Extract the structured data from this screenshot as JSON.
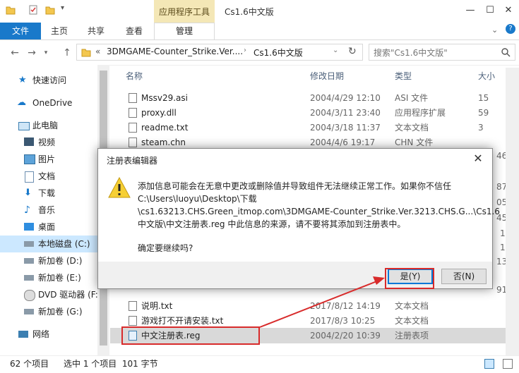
{
  "window": {
    "title": "Cs1.6中文版",
    "context_tab": "应用程序工具",
    "controls": [
      "—",
      "☐",
      "✕"
    ]
  },
  "ribbon": {
    "file": "文件",
    "tabs": [
      "主页",
      "共享",
      "查看"
    ],
    "manage": "管理"
  },
  "address": {
    "overflow": "«",
    "segments": [
      "3DMGAME-Counter_Strike.Ver....",
      "Cs1.6中文版"
    ],
    "search_placeholder": "搜索\"Cs1.6中文版\""
  },
  "nav": {
    "items": [
      {
        "label": "快速访问",
        "icon": "star-icon"
      },
      {
        "label": "OneDrive",
        "icon": "cloud-icon"
      },
      {
        "label": "此电脑",
        "icon": "computer-icon"
      },
      {
        "label": "视频",
        "icon": "video-icon"
      },
      {
        "label": "图片",
        "icon": "picture-icon"
      },
      {
        "label": "文档",
        "icon": "document-icon"
      },
      {
        "label": "下载",
        "icon": "download-icon"
      },
      {
        "label": "音乐",
        "icon": "music-icon"
      },
      {
        "label": "桌面",
        "icon": "desktop-icon"
      },
      {
        "label": "本地磁盘 (C:)",
        "icon": "drive-icon"
      },
      {
        "label": "新加卷 (D:)",
        "icon": "drive-icon"
      },
      {
        "label": "新加卷 (E:)",
        "icon": "drive-icon"
      },
      {
        "label": "DVD 驱动器 (F:)",
        "icon": "dvd-icon"
      },
      {
        "label": "新加卷 (G:)",
        "icon": "drive-icon"
      },
      {
        "label": "网络",
        "icon": "network-icon"
      }
    ]
  },
  "files": {
    "columns": {
      "name": "名称",
      "date": "修改日期",
      "type": "类型",
      "size": "大小"
    },
    "rows": [
      {
        "name": "Mssv29.asi",
        "date": "2004/4/29 12:10",
        "type": "ASI 文件",
        "size": "15"
      },
      {
        "name": "proxy.dll",
        "date": "2004/3/11 23:40",
        "type": "应用程序扩展",
        "size": "59"
      },
      {
        "name": "readme.txt",
        "date": "2004/3/18 11:37",
        "type": "文本文档",
        "size": "3"
      },
      {
        "name": "steam.chn",
        "date": "2004/4/6 19:17",
        "type": "CHN 文件",
        "size": ""
      },
      {
        "name": "说明.txt",
        "date": "2017/8/12 14:19",
        "type": "文本文档",
        "size": ""
      },
      {
        "name": "游戏打不开请安装.txt",
        "date": "2017/8/3 10:25",
        "type": "文本文档",
        "size": ""
      },
      {
        "name": "中文注册表.reg",
        "date": "2004/2/20 10:39",
        "type": "注册表项",
        "size": ""
      }
    ],
    "side_fragments": [
      "46",
      "87",
      "05",
      "45",
      "1",
      "1",
      "13",
      "91"
    ]
  },
  "status": {
    "count": "62 个项目",
    "selection": "选中 1 个项目  101 字节"
  },
  "dialog": {
    "title": "注册表编辑器",
    "close": "✕",
    "message_lines": [
      "添加信息可能会在无意中更改或删除值并导致组件无法继续正常工作。如果你不信任",
      "C:\\Users\\luoyu\\Desktop\\下载",
      "\\cs1.63213.CHS.Green_itmop.com\\3DMGAME-Counter_Strike.Ver.3213.CHS.G...\\Cs1.6",
      "中文版\\中文注册表.reg 中此信息的来源，请不要将其添加到注册表中。"
    ],
    "confirm": "确定要继续吗?",
    "yes": "是(Y)",
    "no": "否(N)"
  },
  "colors": {
    "accent": "#1979ca",
    "annotation": "#d82b2b",
    "context_tab": "#f4e7b6"
  }
}
